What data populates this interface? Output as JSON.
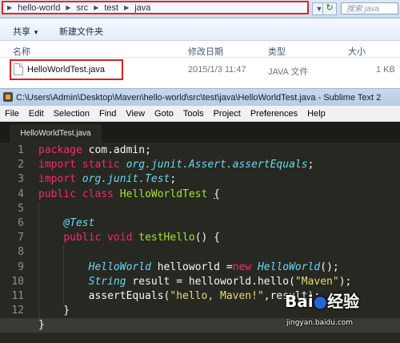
{
  "explorer": {
    "breadcrumb": [
      "hello-world",
      "src",
      "test",
      "java"
    ],
    "search_placeholder": "搜索 java",
    "toolbar": {
      "share_label": "共享",
      "share_arrow": "▼",
      "new_folder_label": "新建文件夹"
    },
    "columns": {
      "name": "名称",
      "modified": "修改日期",
      "type": "类型",
      "size": "大小"
    },
    "file": {
      "name": "HelloWorldTest.java",
      "modified": "2015/1/3 11:47",
      "type": "JAVA 文件",
      "size": "1 KB"
    }
  },
  "sublime": {
    "title": "C:\\Users\\Admin\\Desktop\\Maven\\hello-world\\src\\test\\java\\HelloWorldTest.java - Sublime Text 2",
    "menu": [
      "File",
      "Edit",
      "Selection",
      "Find",
      "View",
      "Goto",
      "Tools",
      "Project",
      "Preferences",
      "Help"
    ],
    "tab_label": "HelloWorldTest.java",
    "current_line": 13,
    "code_lines": [
      {
        "n": "1",
        "t": "package com.admin;"
      },
      {
        "n": "2",
        "t": "import static org.junit.Assert.assertEquals;"
      },
      {
        "n": "3",
        "t": "import org.junit.Test;"
      },
      {
        "n": "4",
        "t": "public class HelloWorldTest {"
      },
      {
        "n": "5",
        "t": ""
      },
      {
        "n": "6",
        "t": "    @Test"
      },
      {
        "n": "7",
        "t": "    public void testHello() {"
      },
      {
        "n": "8",
        "t": ""
      },
      {
        "n": "9",
        "t": "        HelloWorld helloworld =new HelloWorld();"
      },
      {
        "n": "10",
        "t": "        String result = helloworld.hello(\"Maven\");"
      },
      {
        "n": "11",
        "t": "        assertEquals(\"hello, Maven!\",result);"
      },
      {
        "n": "12",
        "t": "    }"
      },
      {
        "n": "13",
        "t": "}"
      }
    ]
  },
  "watermark": {
    "logo_text": "Bai",
    "logo_mid": "du",
    "logo_tail": "经验",
    "url": "jingyan.baidu.com"
  },
  "colors": {
    "editor_bg": "#272822",
    "keyword": "#f92672",
    "string": "#e6db74",
    "type": "#66d9ef",
    "function": "#a6e22e",
    "highlight_red": "#d9202b"
  }
}
